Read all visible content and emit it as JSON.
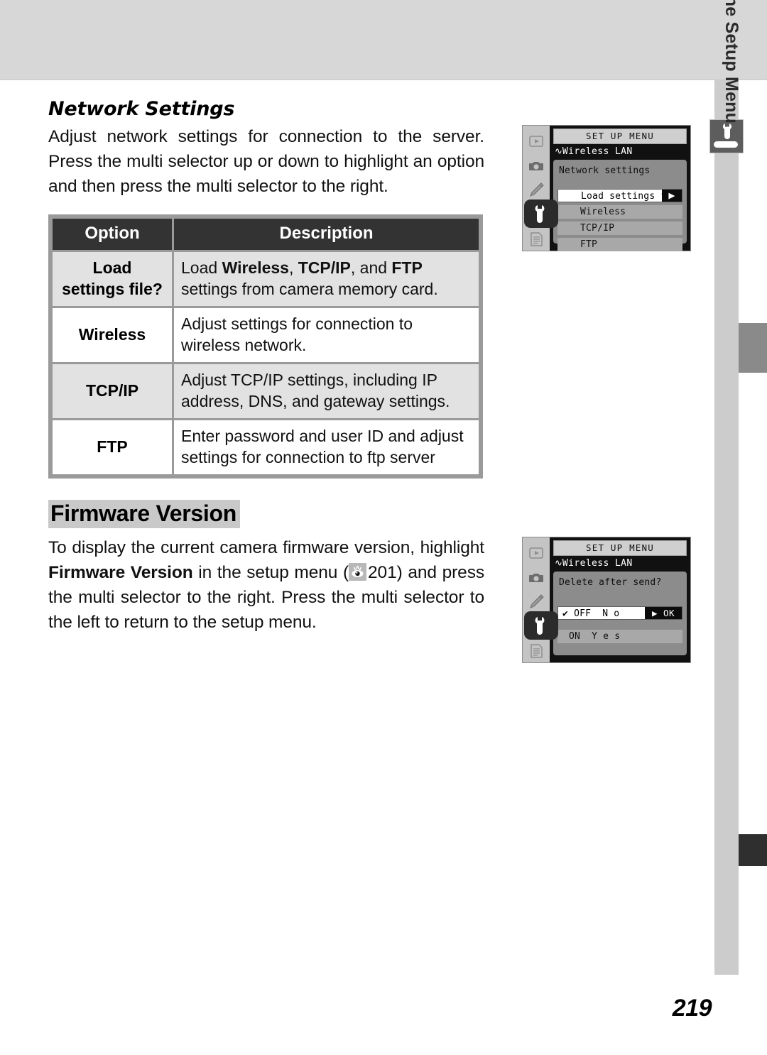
{
  "page": {
    "number": "219",
    "sidebar_label": "Menu Guide—The Setup Menu",
    "sidebar_icon": "wrench-setup-icon"
  },
  "section": {
    "title": "Network Settings",
    "intro": "Adjust network settings for connection to the server.  Press the multi selector up or down to highlight an option and then press the multi selector to the right."
  },
  "table": {
    "headers": {
      "option": "Option",
      "description": "Description"
    },
    "rows": [
      {
        "option": "Load settings file?",
        "option_line1": "Load",
        "option_line2": "settings file?",
        "desc_prefix": "Load ",
        "desc_b1": "Wireless",
        "desc_mid1": ", ",
        "desc_b2": "TCP/IP",
        "desc_mid2": ", and ",
        "desc_b3": "FTP",
        "desc_suffix": " settings from camera memory card.",
        "shaded": true
      },
      {
        "option": "Wireless",
        "description": "Adjust settings for connection to wireless network.",
        "shaded": false
      },
      {
        "option": "TCP/IP",
        "description": "Adjust TCP/IP settings, including IP address, DNS, and gateway settings.",
        "shaded": true
      },
      {
        "option": "FTP",
        "description": "Enter password and user ID and adjust settings for connection to ftp server",
        "shaded": false
      }
    ]
  },
  "firmware": {
    "heading": "Firmware Version",
    "body_part1": "To display the current camera firmware version, highlight ",
    "body_bold": "Firmware Version",
    "body_part2": " in the setup menu (",
    "body_ref": "201",
    "body_part3": ") and press the multi selector to the right. Press the multi selector to the left to return to the setup menu.",
    "ref_icon": "eye-reference-icon"
  },
  "lcd_top": {
    "title": "SET UP MENU",
    "subtitle": "Wireless LAN",
    "wave_icon": "wireless-wave-icon",
    "prompt": "Network settings",
    "items": [
      {
        "label": "Load settings file",
        "selected": true,
        "arrow": "▶"
      },
      {
        "label": "Wireless",
        "selected": false
      },
      {
        "label": "TCP/IP",
        "selected": false
      },
      {
        "label": "FTP",
        "selected": false
      }
    ],
    "icons": [
      "playback-icon",
      "camera-icon",
      "pencil-icon",
      "wrench-icon",
      "list-icon"
    ]
  },
  "lcd_bottom": {
    "title": "SET UP MENU",
    "subtitle": "Wireless LAN",
    "wave_icon": "wireless-wave-icon",
    "prompt": "Delete after send?",
    "selected_row": {
      "check": "✔",
      "state": "OFF",
      "label": "N o",
      "ok_label": "▶ OK"
    },
    "other_row": {
      "state": "ON",
      "label": "Y e s"
    },
    "icons": [
      "playback-icon",
      "camera-icon",
      "pencil-icon",
      "wrench-icon",
      "list-icon"
    ]
  }
}
